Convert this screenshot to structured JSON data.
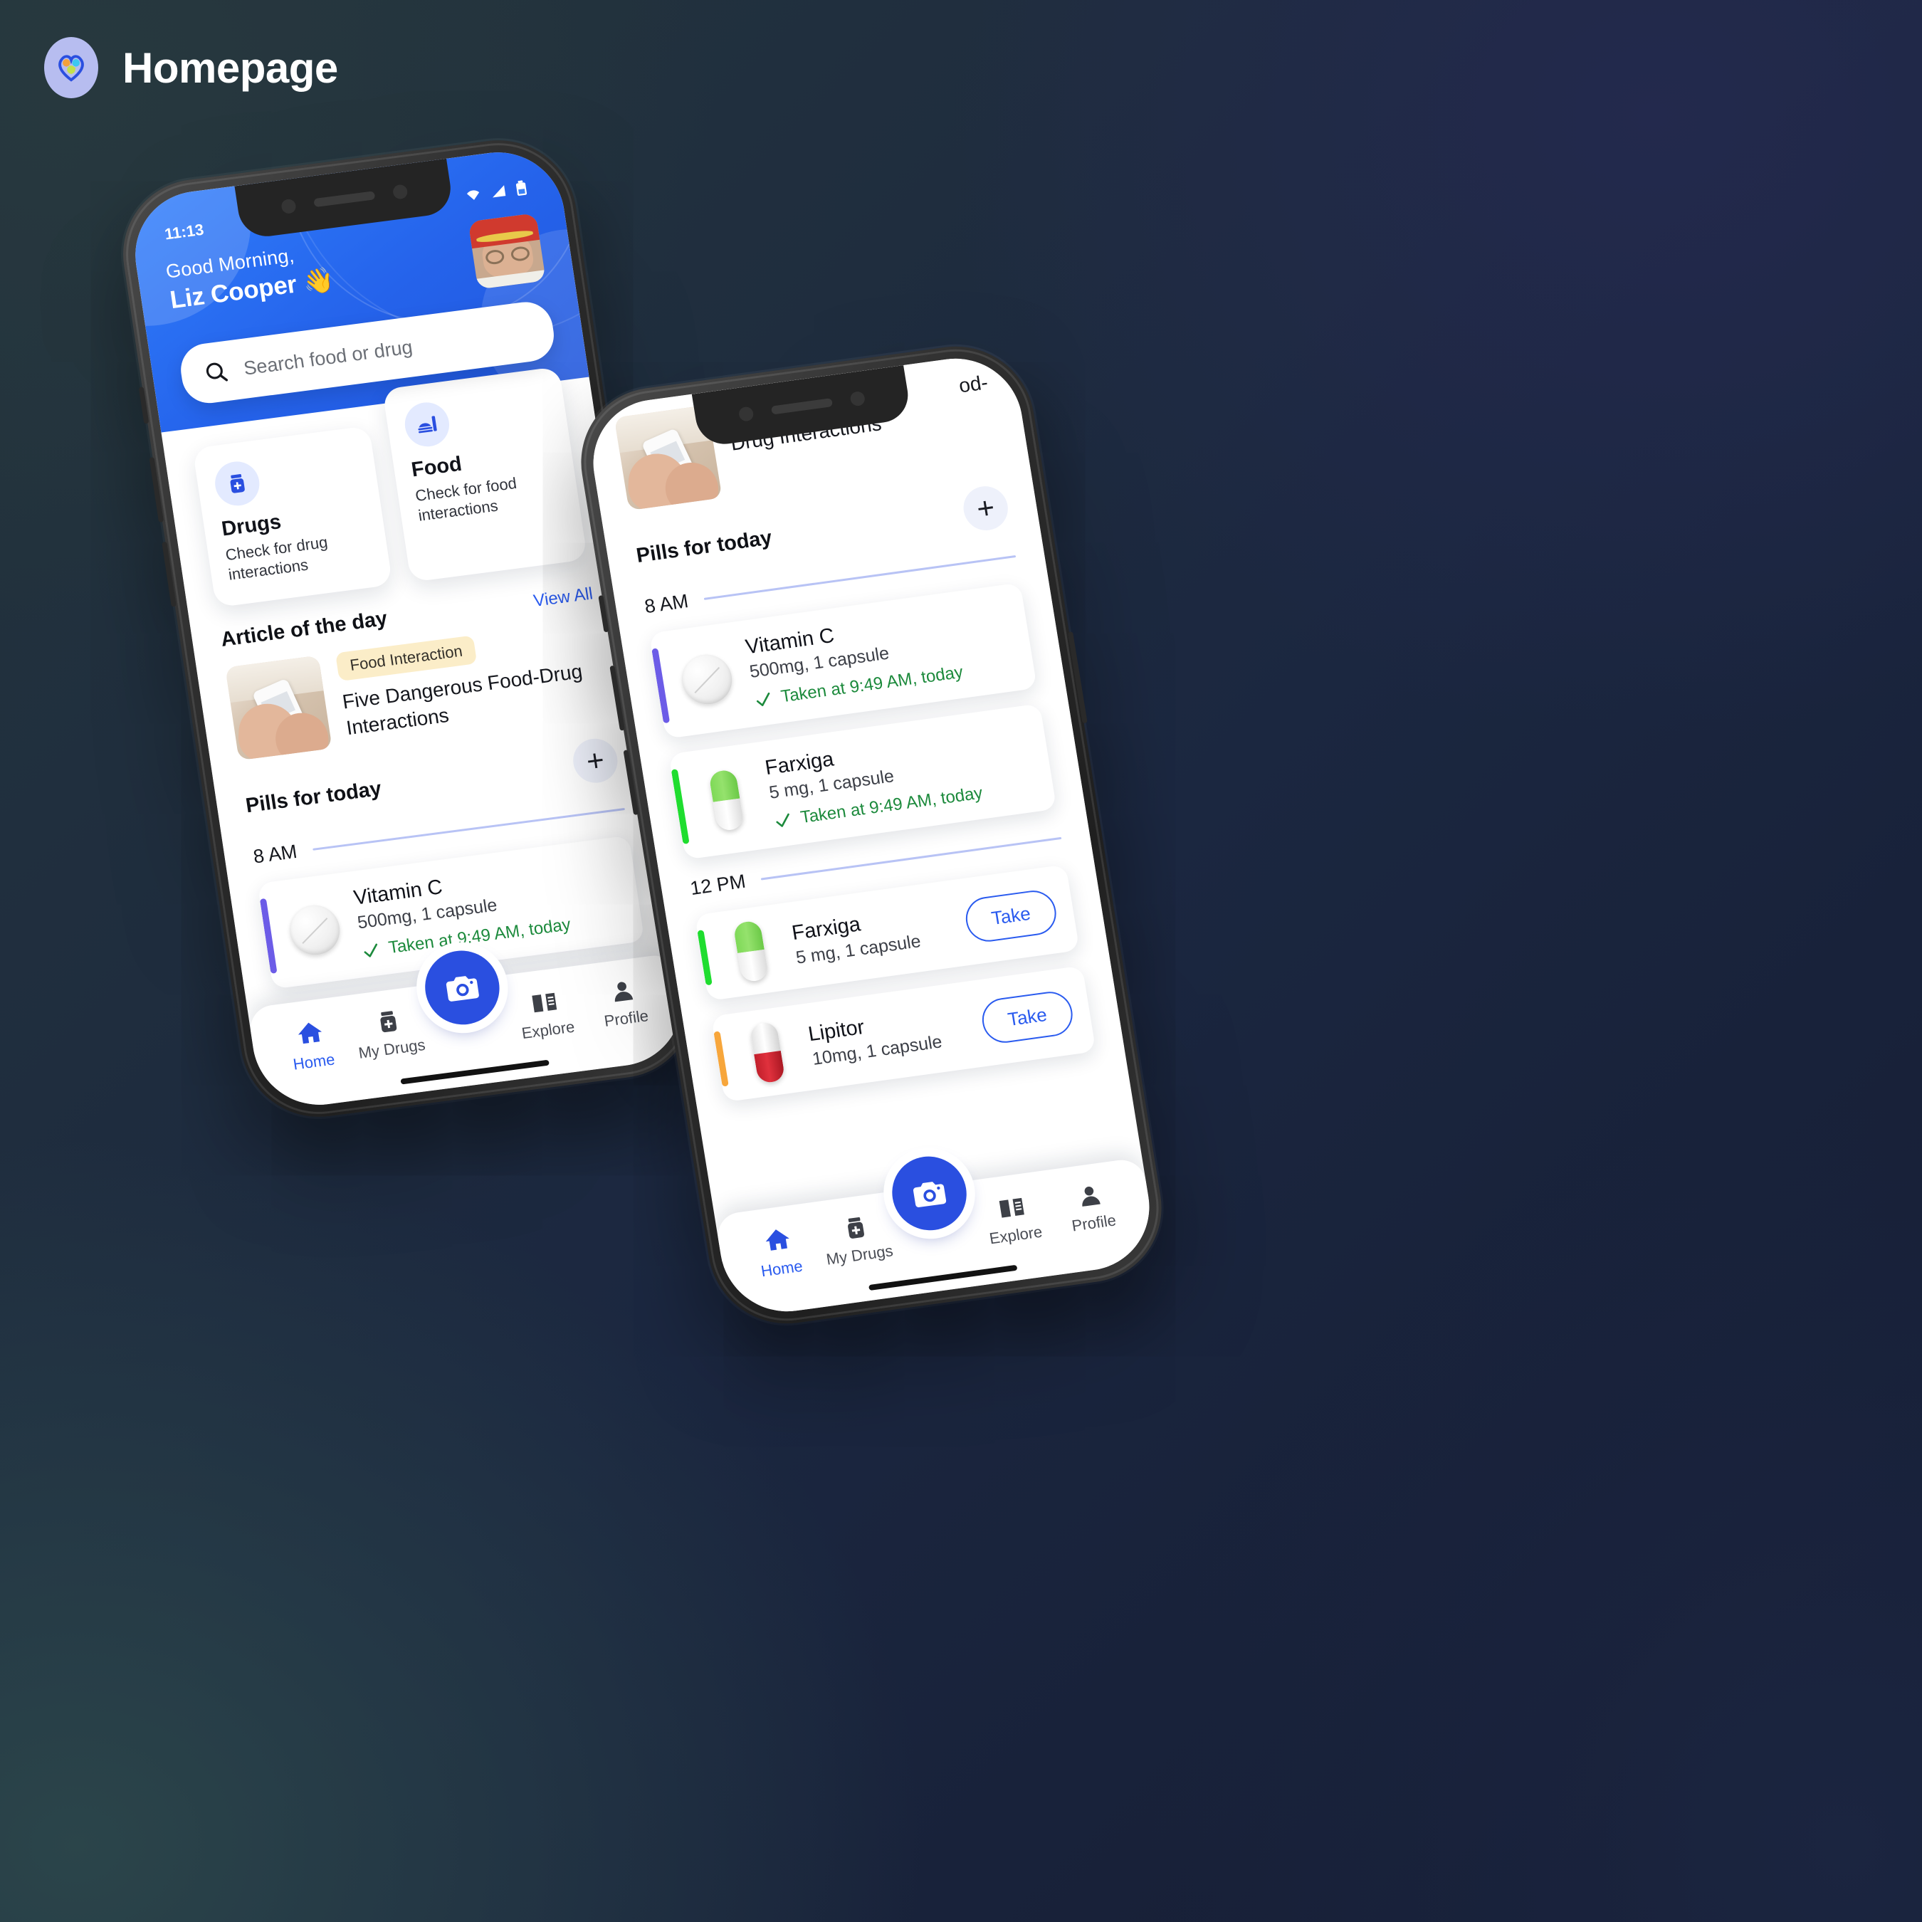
{
  "brand": {
    "title": "Homepage",
    "logo_icon": "heart-pills-logo"
  },
  "colors": {
    "accent_blue": "#2a5bef",
    "hero_blue": "#2563eb",
    "taken_green": "#1c8a3c",
    "tag_yellow": "#fbedc8",
    "bar_purple": "#6c5ce7",
    "bar_green": "#1fdd2f",
    "bar_orange": "#f7a63b",
    "bg_dark_teal": "#24353c",
    "bg_dark_navy": "#222c4f"
  },
  "phone1": {
    "status": {
      "time": "11:13",
      "icons": [
        "wifi-icon",
        "cellular-icon",
        "battery-icon"
      ]
    },
    "header": {
      "greeting": "Good Morning,",
      "name": "Liz Cooper 👋",
      "avatar_alt": "user-avatar"
    },
    "search": {
      "placeholder": "Search food or drug",
      "icon": "search-icon"
    },
    "features": [
      {
        "icon": "pill-bottle-icon",
        "title": "Drugs",
        "subtitle": "Check for drug interactions"
      },
      {
        "icon": "food-tray-icon",
        "title": "Food",
        "subtitle": "Check for food interactions"
      }
    ],
    "article_section": {
      "title": "Article of the day",
      "view_all": "View All",
      "article": {
        "tag": "Food Interaction",
        "title": "Five Dangerous Food-Drug Interactions",
        "thumb_alt": "hands-holding-pill-bottle"
      }
    },
    "pills_section": {
      "title": "Pills for today",
      "add_label": "+",
      "groups": [
        {
          "time": "8 AM",
          "items": [
            {
              "name": "Vitamin C",
              "dose": "500mg, 1 capsule",
              "status": "Taken at 9:49 AM, today",
              "accent": "purple",
              "shape": "tablet"
            }
          ]
        }
      ]
    },
    "nav": {
      "items": [
        {
          "label": "Home",
          "icon": "home-icon",
          "active": true
        },
        {
          "label": "My Drugs",
          "icon": "pill-bottle-icon",
          "active": false
        },
        {
          "label": "Explore",
          "icon": "book-icon",
          "active": false
        },
        {
          "label": "Profile",
          "icon": "person-icon",
          "active": false
        }
      ],
      "fab_icon": "camera-icon"
    }
  },
  "phone2": {
    "article_tail": {
      "line1": "od-",
      "line2": "Drug Interactions",
      "thumb_alt": "hands-holding-pill-bottle"
    },
    "pills_section": {
      "title": "Pills for today",
      "add_label": "+",
      "groups": [
        {
          "time": "8 AM",
          "items": [
            {
              "name": "Vitamin C",
              "dose": "500mg, 1 capsule",
              "status": "Taken at 9:49 AM, today",
              "accent": "purple",
              "shape": "tablet",
              "action": null
            },
            {
              "name": "Farxiga",
              "dose": "5 mg, 1 capsule",
              "status": "Taken at 9:49 AM, today",
              "accent": "green",
              "shape": "capsule-green",
              "action": null
            }
          ]
        },
        {
          "time": "12 PM",
          "items": [
            {
              "name": "Farxiga",
              "dose": "5 mg, 1 capsule",
              "status": null,
              "accent": "green",
              "shape": "capsule-green",
              "action": "Take"
            },
            {
              "name": "Lipitor",
              "dose": "10mg, 1 capsule",
              "status": null,
              "accent": "orange",
              "shape": "capsule-red",
              "action": "Take"
            }
          ]
        }
      ]
    },
    "nav": {
      "items": [
        {
          "label": "Home",
          "icon": "home-icon",
          "active": true
        },
        {
          "label": "My Drugs",
          "icon": "pill-bottle-icon",
          "active": false
        },
        {
          "label": "Explore",
          "icon": "book-icon",
          "active": false
        },
        {
          "label": "Profile",
          "icon": "person-icon",
          "active": false
        }
      ],
      "fab_icon": "camera-icon"
    }
  }
}
